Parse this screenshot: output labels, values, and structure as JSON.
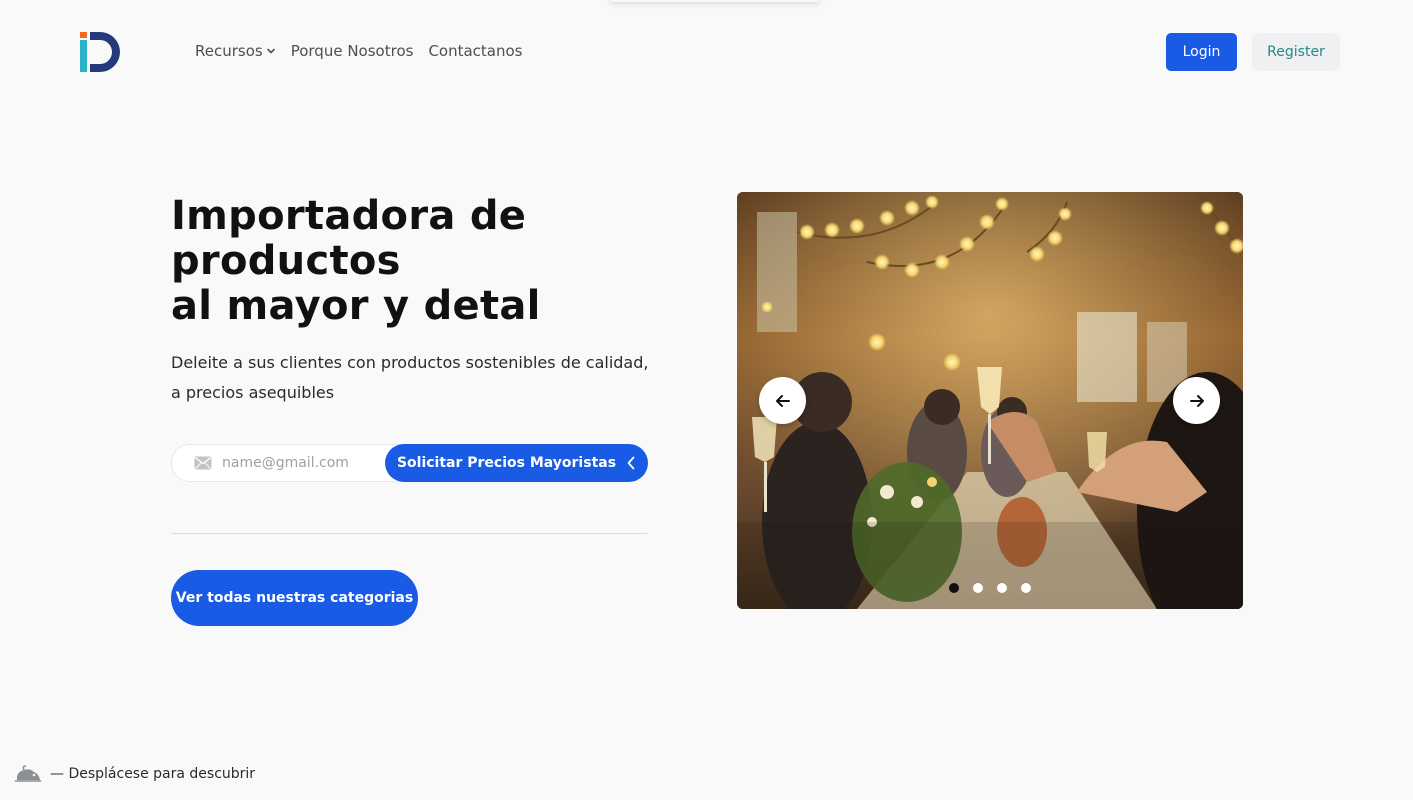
{
  "header": {
    "nav": [
      {
        "label": "Recursos",
        "has_dropdown": true
      },
      {
        "label": "Porque Nosotros"
      },
      {
        "label": "Contactanos"
      }
    ],
    "login_label": "Login",
    "register_label": "Register"
  },
  "hero": {
    "title_lines": [
      "Importadora de",
      "productos",
      "al mayor y detal"
    ],
    "subtitle": "Deleite a sus clientes con productos sostenibles de calidad, a precios asequibles",
    "email_placeholder": "name@gmail.com",
    "email_value": "",
    "cta_label": "Solicitar Precios Mayoristas",
    "categories_label": "Ver todas nuestras categorias"
  },
  "carousel": {
    "slide_count": 4,
    "active_index": 0
  },
  "scroll_hint": {
    "text": "— Desplácese para descubrir"
  },
  "colors": {
    "primary": "#1a5be6",
    "register_text": "#258a8a",
    "logo_orange": "#f26a1b",
    "logo_cyan": "#2ab3c6",
    "logo_navy": "#253a7a"
  },
  "icons": {
    "logo": "brand-logo",
    "dropdown": "chevron-down-icon",
    "mail": "mail-icon",
    "cta": "chevron-left-icon",
    "prev": "arrow-left-icon",
    "next": "arrow-right-icon",
    "scroll": "mouse-icon"
  }
}
